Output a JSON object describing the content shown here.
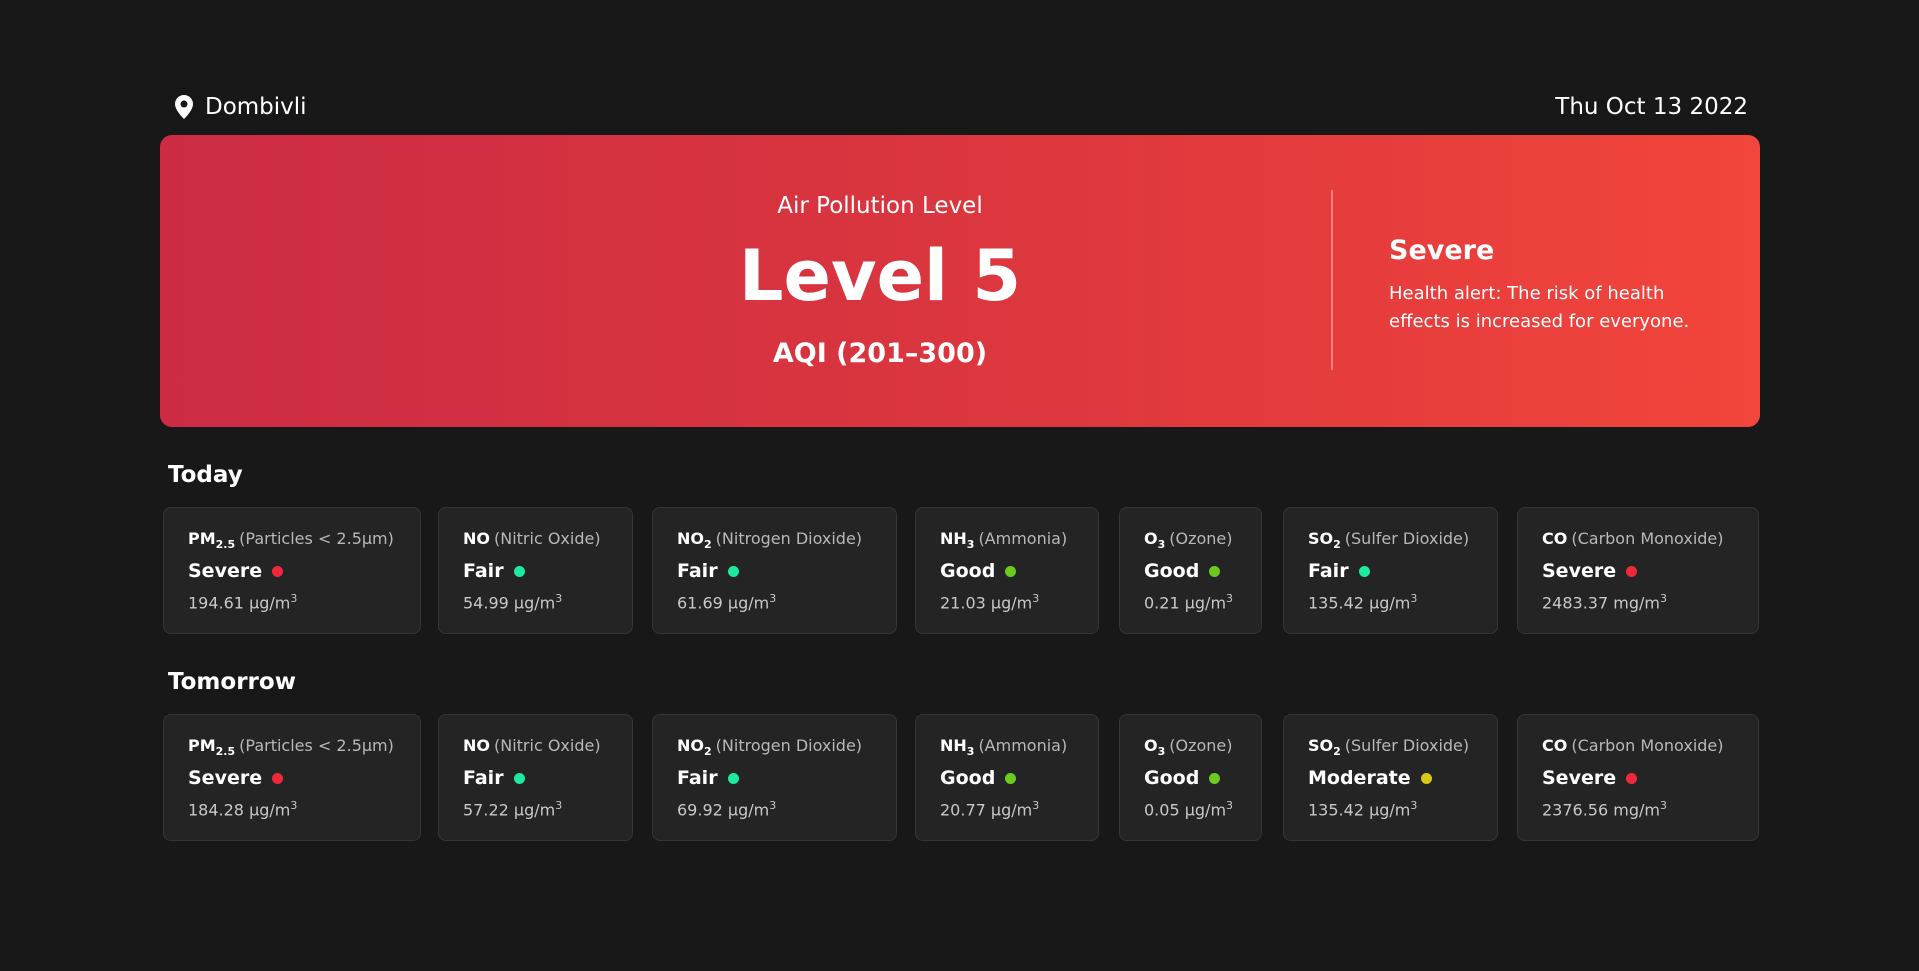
{
  "location": "Dombivli",
  "date": "Thu Oct 13 2022",
  "hero": {
    "label": "Air Pollution Level",
    "level": "Level 5",
    "aqi": "AQI (201–300)",
    "status": "Severe",
    "description": "Health alert: The risk of health effects is increased for everyone."
  },
  "colors": {
    "severe": "#f0283c",
    "fair": "#1de9a0",
    "good": "#6cc91f",
    "moderate": "#d6c814"
  },
  "today": {
    "title": "Today",
    "cards": [
      {
        "formula": "PM",
        "sub": "2.5",
        "name": "(Particles < 2.5µm)",
        "status": "Severe",
        "color": "#f0283c",
        "value": "194.61",
        "unit": "µg/m",
        "exp": "3"
      },
      {
        "formula": "NO",
        "sub": "",
        "name": "(Nitric Oxide)",
        "status": "Fair",
        "color": "#1de9a0",
        "value": "54.99",
        "unit": "µg/m",
        "exp": "3"
      },
      {
        "formula": "NO",
        "sub": "2",
        "name": "(Nitrogen Dioxide)",
        "status": "Fair",
        "color": "#1de9a0",
        "value": "61.69",
        "unit": "µg/m",
        "exp": "3"
      },
      {
        "formula": "NH",
        "sub": "3",
        "name": "(Ammonia)",
        "status": "Good",
        "color": "#6cc91f",
        "value": "21.03",
        "unit": "µg/m",
        "exp": "3"
      },
      {
        "formula": "O",
        "sub": "3",
        "name": "(Ozone)",
        "status": "Good",
        "color": "#6cc91f",
        "value": "0.21",
        "unit": "µg/m",
        "exp": "3"
      },
      {
        "formula": "SO",
        "sub": "2",
        "name": "(Sulfer Dioxide)",
        "status": "Fair",
        "color": "#1de9a0",
        "value": "135.42",
        "unit": "µg/m",
        "exp": "3"
      },
      {
        "formula": "CO",
        "sub": "",
        "name": "(Carbon Monoxide)",
        "status": "Severe",
        "color": "#f0283c",
        "value": "2483.37",
        "unit": "mg/m",
        "exp": "3"
      }
    ]
  },
  "tomorrow": {
    "title": "Tomorrow",
    "cards": [
      {
        "formula": "PM",
        "sub": "2.5",
        "name": "(Particles < 2.5µm)",
        "status": "Severe",
        "color": "#f0283c",
        "value": "184.28",
        "unit": "µg/m",
        "exp": "3"
      },
      {
        "formula": "NO",
        "sub": "",
        "name": "(Nitric Oxide)",
        "status": "Fair",
        "color": "#1de9a0",
        "value": "57.22",
        "unit": "µg/m",
        "exp": "3"
      },
      {
        "formula": "NO",
        "sub": "2",
        "name": "(Nitrogen Dioxide)",
        "status": "Fair",
        "color": "#1de9a0",
        "value": "69.92",
        "unit": "µg/m",
        "exp": "3"
      },
      {
        "formula": "NH",
        "sub": "3",
        "name": "(Ammonia)",
        "status": "Good",
        "color": "#6cc91f",
        "value": "20.77",
        "unit": "µg/m",
        "exp": "3"
      },
      {
        "formula": "O",
        "sub": "3",
        "name": "(Ozone)",
        "status": "Good",
        "color": "#6cc91f",
        "value": "0.05",
        "unit": "µg/m",
        "exp": "3"
      },
      {
        "formula": "SO",
        "sub": "2",
        "name": "(Sulfer Dioxide)",
        "status": "Moderate",
        "color": "#d6c814",
        "value": "135.42",
        "unit": "µg/m",
        "exp": "3"
      },
      {
        "formula": "CO",
        "sub": "",
        "name": "(Carbon Monoxide)",
        "status": "Severe",
        "color": "#f0283c",
        "value": "2376.56",
        "unit": "mg/m",
        "exp": "3"
      }
    ]
  }
}
